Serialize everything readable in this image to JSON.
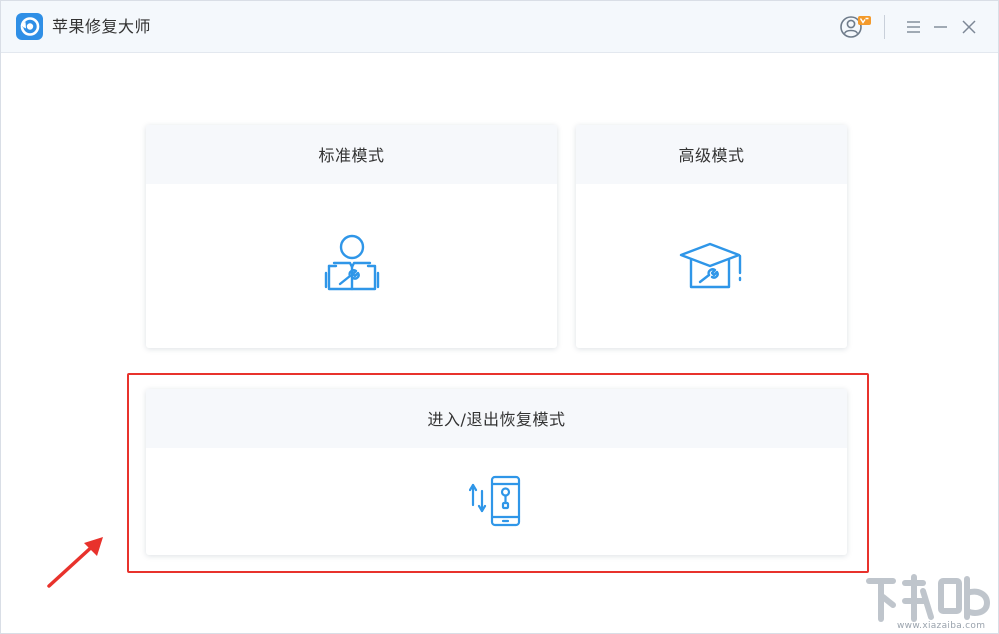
{
  "app": {
    "title": "苹果修复大师",
    "logo_icon": "app-logo-icon"
  },
  "titlebar": {
    "user_icon": "user-vip-icon",
    "vip_badge_color": "#f39a2b",
    "menu_icon": "menu-icon",
    "minimize_icon": "minimize-icon",
    "close_icon": "close-icon"
  },
  "modes": {
    "standard": {
      "label": "标准模式",
      "icon": "person-repair-book-icon"
    },
    "advanced": {
      "label": "高级模式",
      "icon": "graduation-cap-wrench-icon"
    },
    "recovery": {
      "label": "进入/退出恢复模式",
      "icon": "phone-recovery-mode-icon"
    }
  },
  "colors": {
    "accent": "#2f96e8",
    "annotation": "#e8322c",
    "header_bg": "#f6f8fb",
    "titlebar_bg": "#f4f8fc"
  },
  "annotation": {
    "highlight": "red-highlight-box",
    "arrow": "red-arrow"
  },
  "watermark": {
    "url": "www.xiazaiba.com"
  }
}
